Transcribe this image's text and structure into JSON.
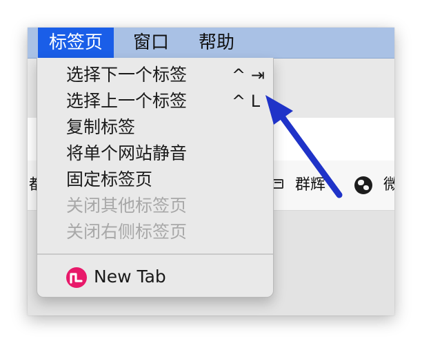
{
  "menubar": {
    "items": [
      {
        "label": "标签页",
        "active": true
      },
      {
        "label": "窗口",
        "active": false
      },
      {
        "label": "帮助",
        "active": false
      }
    ]
  },
  "bookmarks": {
    "left_partial": "都",
    "item_1": "群辉",
    "item_2_partial": "微"
  },
  "tab_menu": {
    "items": [
      {
        "label": "选择下一个标签",
        "shortcut": "^ ⇥",
        "enabled": true
      },
      {
        "label": "选择上一个标签",
        "shortcut": "^ L",
        "enabled": true
      },
      {
        "label": "复制标签",
        "shortcut": "",
        "enabled": true
      },
      {
        "label": "将单个网站静音",
        "shortcut": "",
        "enabled": true
      },
      {
        "label": "固定标签页",
        "shortcut": "",
        "enabled": true
      },
      {
        "label": "关闭其他标签页",
        "shortcut": "",
        "enabled": false
      },
      {
        "label": "关闭右侧标签页",
        "shortcut": "",
        "enabled": false
      }
    ],
    "new_tab": {
      "label": "New Tab",
      "icon": "new-tab-app-icon"
    }
  },
  "colors": {
    "menubar_bg": "#a9c1e5",
    "menu_active": "#1a5ee8",
    "annotation_arrow": "#1f33c8",
    "new_tab_icon": "#e8196a"
  }
}
